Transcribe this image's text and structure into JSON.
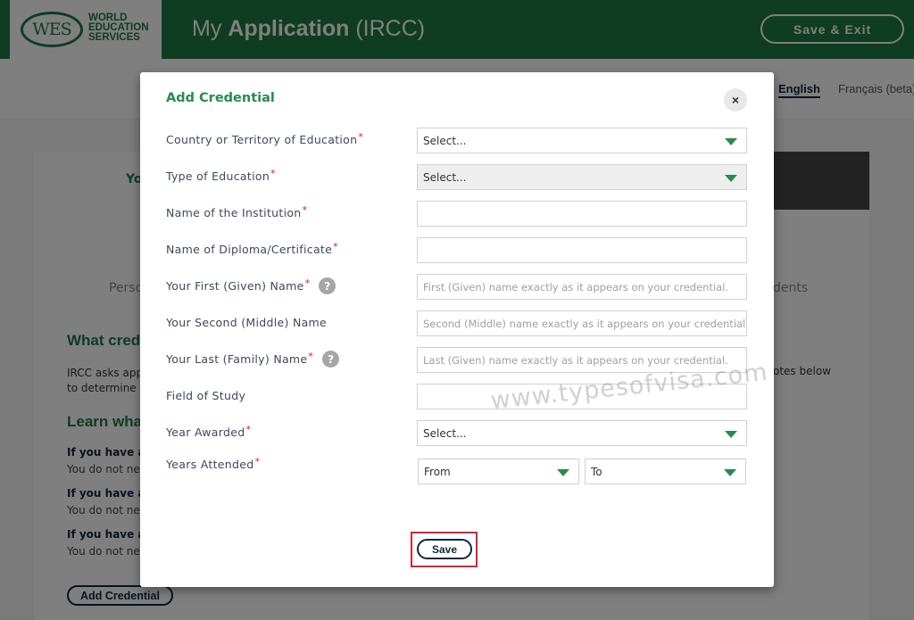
{
  "header": {
    "logo_mark": "WES",
    "logo_lines": [
      "WORLD",
      "EDUCATION",
      "SERVICES"
    ],
    "title_prefix": "My",
    "title_bold": "Application",
    "title_suffix": "(IRCC)",
    "save_exit_label": "Save & Exit"
  },
  "language": {
    "english": "English",
    "french": "Français (beta)",
    "active": "English"
  },
  "background_page": {
    "step_fragment": "Yo",
    "tab_left_fragment": "Perso",
    "tab_right_fragment": "dents",
    "section_heading_fragment": "What cred",
    "intro_line1_fragment": "IRCC asks appl",
    "intro_line2_fragment": "to determine w",
    "intro_right_fragment": "otes below",
    "learn_heading_fragment": "Learn wha",
    "faq": [
      {
        "question_fragment": "If you have a c",
        "answer_fragment": "You do not nee"
      },
      {
        "question_fragment": "If you have a r",
        "answer_fragment": "You do not nee"
      },
      {
        "question_fragment": "If you have a b",
        "answer_fragment": "You do not nee"
      }
    ],
    "add_credential_label": "Add Credential"
  },
  "modal": {
    "title": "Add Credential",
    "close_label": "×",
    "required_marker": "*",
    "help_glyph": "?",
    "fields": {
      "country": {
        "label": "Country or Territory of Education",
        "required": true,
        "type": "select",
        "value": "Select..."
      },
      "education_type": {
        "label": "Type of Education",
        "required": true,
        "type": "select",
        "value": "Select..."
      },
      "institution": {
        "label": "Name of the Institution",
        "required": true,
        "type": "text",
        "value": "",
        "placeholder": ""
      },
      "diploma": {
        "label": "Name of Diploma/Certificate",
        "required": true,
        "type": "text",
        "value": "",
        "placeholder": ""
      },
      "first_name": {
        "label": "Your First (Given) Name",
        "required": true,
        "type": "text",
        "value": "",
        "placeholder": "First (Given) name exactly as it appears on your credential."
      },
      "middle_name": {
        "label": "Your Second (Middle) Name",
        "required": false,
        "type": "text",
        "value": "",
        "placeholder": "Second (Middle) name exactly as it appears on your credential."
      },
      "last_name": {
        "label": "Your Last (Family) Name",
        "required": true,
        "type": "text",
        "value": "",
        "placeholder": "Last (Given) name exactly as it appears on your credential."
      },
      "field_of_study": {
        "label": "Field of Study",
        "required": false,
        "type": "text",
        "value": "",
        "placeholder": ""
      },
      "year_awarded": {
        "label": "Year Awarded",
        "required": true,
        "type": "select",
        "value": "Select..."
      },
      "years_attended": {
        "label": "Years Attended",
        "required": true,
        "from": "From",
        "to": "To"
      }
    },
    "save_label": "Save"
  },
  "watermark": "www.typesofvisa.com",
  "colors": {
    "brand_green": "#1e7a45",
    "title_green": "#2a8a4e",
    "navy": "#0d2840",
    "required_red": "#c0282d",
    "highlight_red": "#d02630"
  }
}
